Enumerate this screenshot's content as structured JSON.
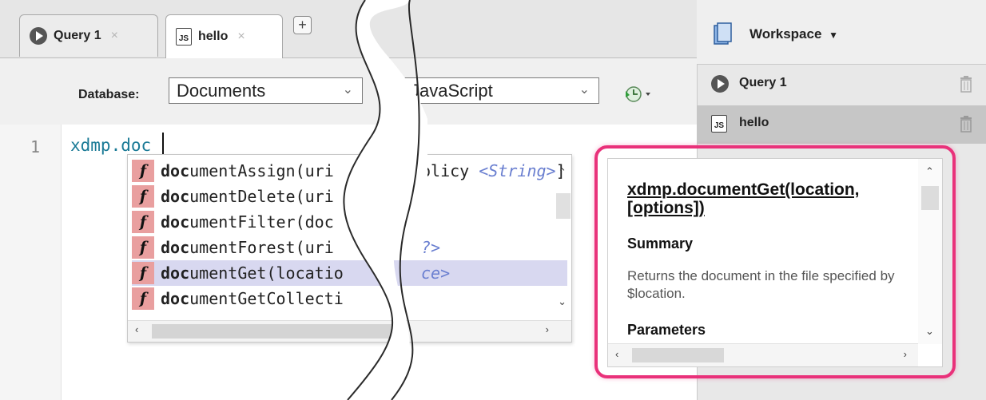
{
  "tabs": [
    {
      "label": "Query 1",
      "icon": "query-icon",
      "close": "×"
    },
    {
      "label": "hello",
      "icon": "js-file-icon",
      "icon_text": "JS",
      "close": "×"
    }
  ],
  "new_tab_label": "+",
  "toolbar": {
    "database_label": "Database:",
    "database_value": "Documents",
    "language_value": "JavaScript"
  },
  "editor": {
    "line_number": "1",
    "code": "xdmp.doc"
  },
  "autocomplete": {
    "items": [
      {
        "match": "doc",
        "rest": "umentAssign(uri",
        "tail": "olicy ",
        "type": "<String>",
        "tail2": "]"
      },
      {
        "match": "doc",
        "rest": "umentDelete(uri",
        "tail": "",
        "type": "",
        "tail2": ""
      },
      {
        "match": "doc",
        "rest": "umentFilter(doc",
        "tail": "",
        "type": "",
        "tail2": ""
      },
      {
        "match": "doc",
        "rest": "umentForest(uri",
        "tail": "",
        "type": "?>",
        "tail2": ""
      },
      {
        "match": "doc",
        "rest": "umentGet(locatio",
        "tail": "",
        "type": "ce>",
        "tail2": ""
      },
      {
        "match": "doc",
        "rest": "umentGetCollecti",
        "tail": "",
        "type": "",
        "tail2": ""
      }
    ],
    "selected_index": 4,
    "badge": "f"
  },
  "workspace": {
    "title": "Workspace",
    "items": [
      {
        "label": "Query 1",
        "icon": "query-icon"
      },
      {
        "label": "hello",
        "icon": "js-file-icon",
        "icon_text": "JS"
      }
    ]
  },
  "doc_popup": {
    "title": "xdmp.documentGet(location, [options])",
    "summary_heading": "Summary",
    "summary_text": "Returns the document in the file specified by $location.",
    "params_heading": "Parameters"
  },
  "colors": {
    "highlight": "#e9317a",
    "selected_suggestion": "#d8d8f0",
    "function_badge": "#e99f9f",
    "code_identifier": "#1a7a96"
  }
}
